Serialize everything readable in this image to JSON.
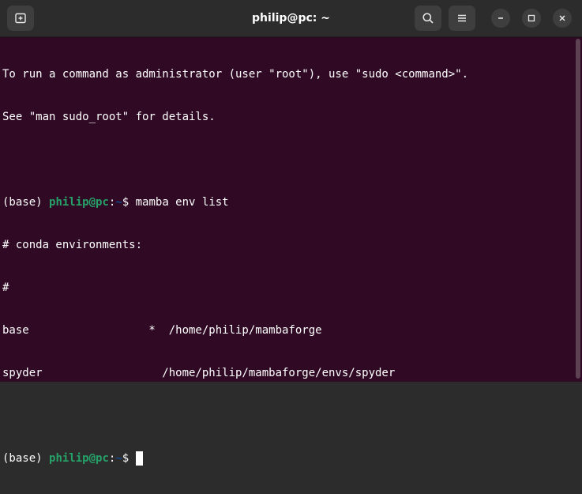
{
  "window": {
    "title": "philip@pc: ~"
  },
  "icons": {
    "new_tab": "new-tab-icon",
    "search": "search-icon",
    "menu": "hamburger-menu-icon",
    "minimize": "minimize-icon",
    "maximize": "maximize-icon",
    "close": "close-icon"
  },
  "colors": {
    "terminal_bg": "#300a24",
    "titlebar_bg": "#2c2c2c",
    "prompt_user": "#26a269",
    "prompt_path": "#12488b",
    "text": "#ffffff"
  },
  "terminal": {
    "motd_line1": "To run a command as administrator (user \"root\"), use \"sudo <command>\".",
    "motd_line2": "See \"man sudo_root\" for details.",
    "prompt1": {
      "env": "(base) ",
      "user": "philip@pc",
      "colon": ":",
      "path": "~",
      "symbol": "$ ",
      "command": "mamba env list"
    },
    "output": [
      "# conda environments:",
      "#",
      "base                  *  /home/philip/mambaforge",
      "spyder                  /home/philip/mambaforge/envs/spyder"
    ],
    "prompt2": {
      "env": "(base) ",
      "user": "philip@pc",
      "colon": ":",
      "path": "~",
      "symbol": "$ "
    }
  }
}
